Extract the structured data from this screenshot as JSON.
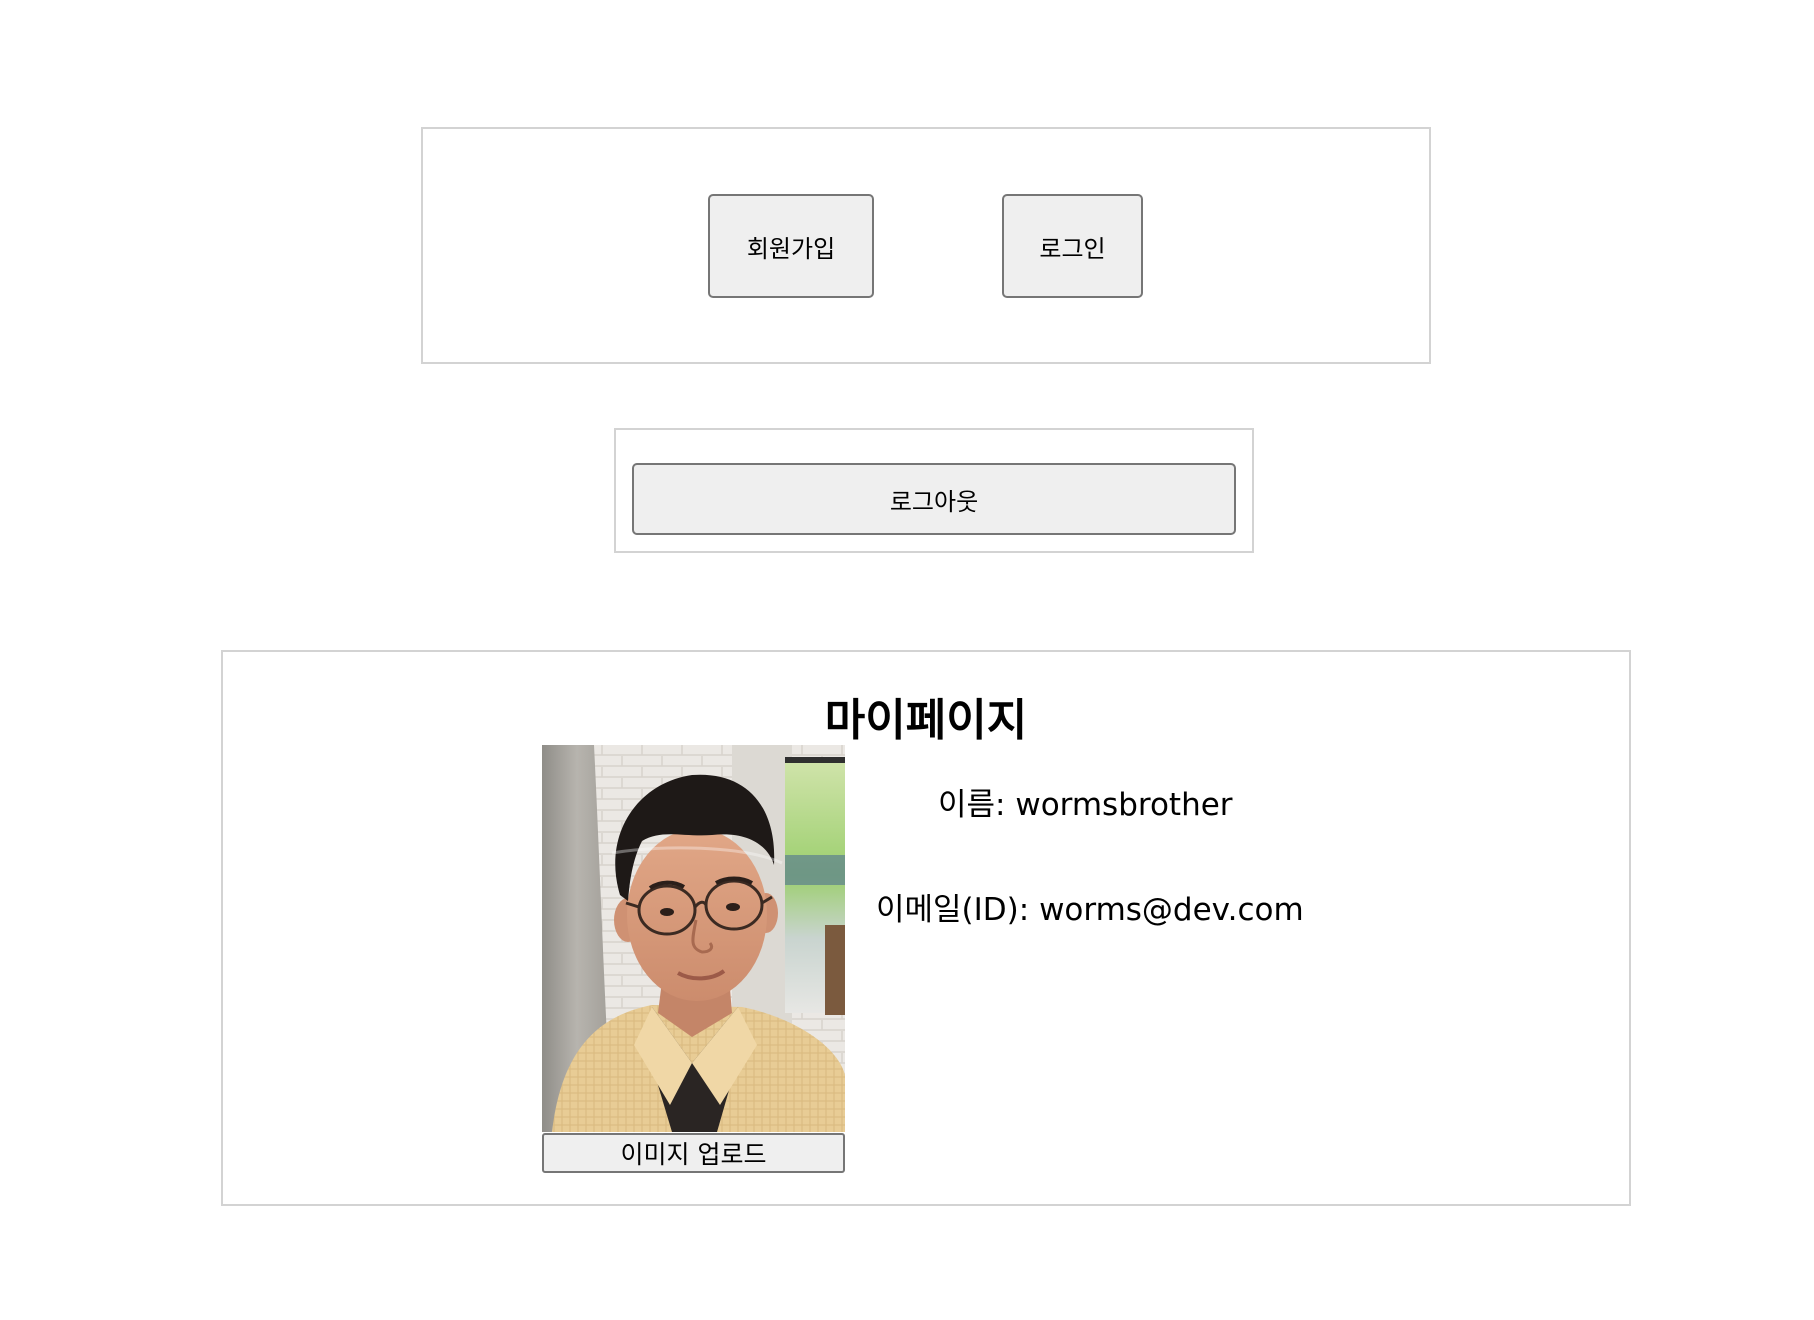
{
  "auth": {
    "signup_label": "회원가입",
    "login_label": "로그인"
  },
  "session": {
    "logout_label": "로그아웃"
  },
  "mypage": {
    "title": "마이페이지",
    "name_label": "이름: ",
    "name_value": "wormsbrother",
    "email_label": "이메일(ID): ",
    "email_value": "worms@dev.com",
    "upload_label": "이미지 업로드"
  },
  "colors": {
    "panel_border": "#d3d3d3",
    "button_bg": "#efefef",
    "button_border": "#767676"
  }
}
